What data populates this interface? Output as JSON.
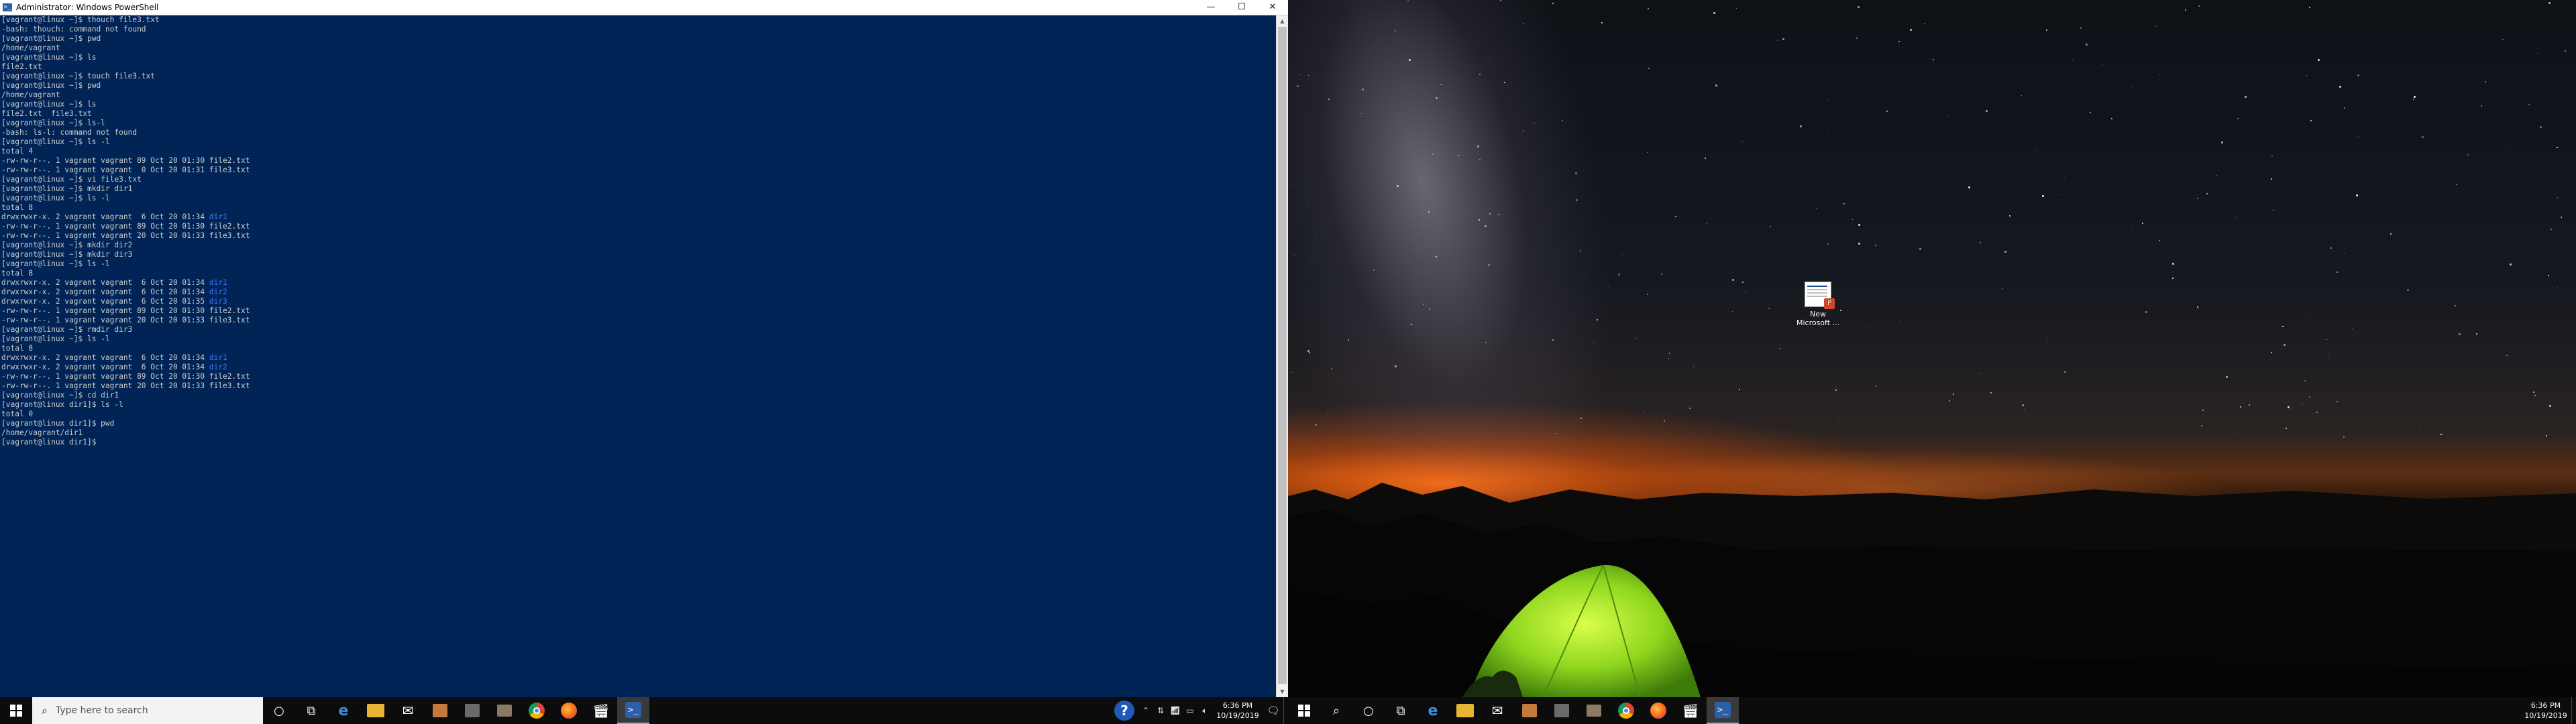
{
  "window": {
    "title": "Administrator: Windows PowerShell",
    "icon": "powershell-icon",
    "controls": {
      "minimize": "—",
      "maximize": "☐",
      "close": "✕"
    }
  },
  "terminal": {
    "lines": [
      "[vagrant@linux ~]$ thouch file3.txt",
      "-bash: thouch: command not found",
      "[vagrant@linux ~]$ pwd",
      "/home/vagrant",
      "[vagrant@linux ~]$ ls",
      "file2.txt",
      "[vagrant@linux ~]$ touch file3.txt",
      "[vagrant@linux ~]$ pwd",
      "/home/vagrant",
      "[vagrant@linux ~]$ ls",
      "file2.txt  file3.txt",
      "[vagrant@linux ~]$ ls-l",
      "-bash: ls-l: command not found",
      "[vagrant@linux ~]$ ls -l",
      "total 4",
      "-rw-rw-r--. 1 vagrant vagrant 89 Oct 20 01:30 file2.txt",
      "-rw-rw-r--. 1 vagrant vagrant  0 Oct 20 01:31 file3.txt",
      "[vagrant@linux ~]$ vi file3.txt",
      "[vagrant@linux ~]$ mkdir dir1",
      "[vagrant@linux ~]$ ls -l",
      "total 8",
      "drwxrwxr-x. 2 vagrant vagrant  6 Oct 20 01:34 dir1",
      "-rw-rw-r--. 1 vagrant vagrant 89 Oct 20 01:30 file2.txt",
      "-rw-rw-r--. 1 vagrant vagrant 20 Oct 20 01:33 file3.txt",
      "[vagrant@linux ~]$ mkdir dir2",
      "[vagrant@linux ~]$ mkdir dir3",
      "[vagrant@linux ~]$ ls -l",
      "total 8",
      "drwxrwxr-x. 2 vagrant vagrant  6 Oct 20 01:34 dir1",
      "drwxrwxr-x. 2 vagrant vagrant  6 Oct 20 01:34 dir2",
      "drwxrwxr-x. 2 vagrant vagrant  6 Oct 20 01:35 dir3",
      "-rw-rw-r--. 1 vagrant vagrant 89 Oct 20 01:30 file2.txt",
      "-rw-rw-r--. 1 vagrant vagrant 20 Oct 20 01:33 file3.txt",
      "[vagrant@linux ~]$ rmdir dir3",
      "[vagrant@linux ~]$ ls -l",
      "total 8",
      "drwxrwxr-x. 2 vagrant vagrant  6 Oct 20 01:34 dir1",
      "drwxrwxr-x. 2 vagrant vagrant  6 Oct 20 01:34 dir2",
      "-rw-rw-r--. 1 vagrant vagrant 89 Oct 20 01:30 file2.txt",
      "-rw-rw-r--. 1 vagrant vagrant 20 Oct 20 01:33 file3.txt",
      "[vagrant@linux ~]$ cd dir1",
      "[vagrant@linux dir1]$ ls -l",
      "total 0",
      "[vagrant@linux dir1]$ pwd",
      "/home/vagrant/dir1",
      "[vagrant@linux dir1]$"
    ],
    "colors": {
      "background": "#012456",
      "text": "#cccccc",
      "directory": "#3b78ff"
    }
  },
  "taskbar_left": {
    "start_icon": "windows-start-icon",
    "search_placeholder": "Type here to search",
    "apps": [
      "cortana-icon",
      "task-view-icon",
      "edge-icon",
      "file-explorer-icon",
      "mail-icon",
      "store-icon",
      "tool-icon",
      "camera-icon",
      "chrome-icon",
      "firefox-icon",
      "video-editor-icon",
      "powershell-icon"
    ],
    "active_app": "powershell-icon",
    "tray": {
      "help": "?",
      "time": "6:36 PM",
      "date": "10/19/2019"
    }
  },
  "taskbar_right": {
    "start_icon": "windows-start-icon",
    "apps": [
      "search-icon",
      "cortana-icon",
      "task-view-icon",
      "edge-icon",
      "file-explorer-icon",
      "mail-icon",
      "store-icon",
      "tool-icon",
      "camera-icon",
      "chrome-icon",
      "firefox-icon",
      "video-editor-icon",
      "powershell-icon"
    ],
    "active_app": "powershell-icon",
    "tray": {
      "time": "6:36 PM",
      "date": "10/19/2019"
    }
  },
  "desktop": {
    "icons": [
      {
        "label_line1": "New",
        "label_line2": "Microsoft ...",
        "icon": "powerpoint-document-icon",
        "badge": "P"
      }
    ],
    "wallpaper": "night-sky-milky-way-tent"
  }
}
